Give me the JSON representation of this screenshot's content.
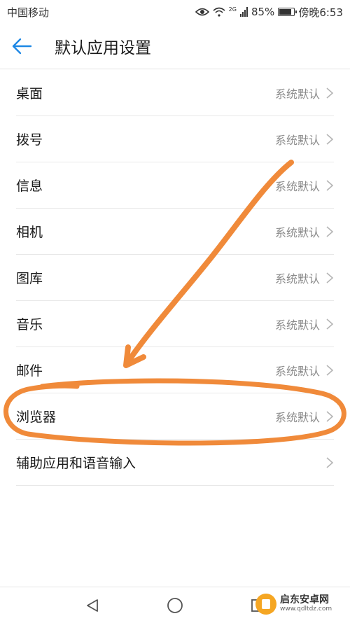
{
  "status_bar": {
    "carrier": "中国移动",
    "network": "2G",
    "battery": "85%",
    "battery_level": 0.85,
    "time": "傍晚6:53",
    "icons": [
      "eye-icon",
      "wifi-icon",
      "signal-icon",
      "battery-icon"
    ]
  },
  "header": {
    "back_icon": "back-arrow-icon",
    "title": "默认应用设置"
  },
  "settings": {
    "items": [
      {
        "label": "桌面",
        "value": "系统默认"
      },
      {
        "label": "拨号",
        "value": "系统默认"
      },
      {
        "label": "信息",
        "value": "系统默认"
      },
      {
        "label": "相机",
        "value": "系统默认"
      },
      {
        "label": "图库",
        "value": "系统默认"
      },
      {
        "label": "音乐",
        "value": "系统默认"
      },
      {
        "label": "邮件",
        "value": "系统默认"
      },
      {
        "label": "浏览器",
        "value": "系统默认"
      },
      {
        "label": "辅助应用和语音输入",
        "value": ""
      }
    ]
  },
  "nav_bar": {
    "icons": [
      "back-triangle-icon",
      "home-circle-icon",
      "recents-square-icon"
    ]
  },
  "watermark": {
    "title": "启东安卓网",
    "url": "www.qdltdz.com"
  },
  "colors": {
    "accent": "#1e88e5",
    "annotation": "#f08a3a",
    "text_primary": "#1a1a1a",
    "text_secondary": "#8a8a8a"
  }
}
